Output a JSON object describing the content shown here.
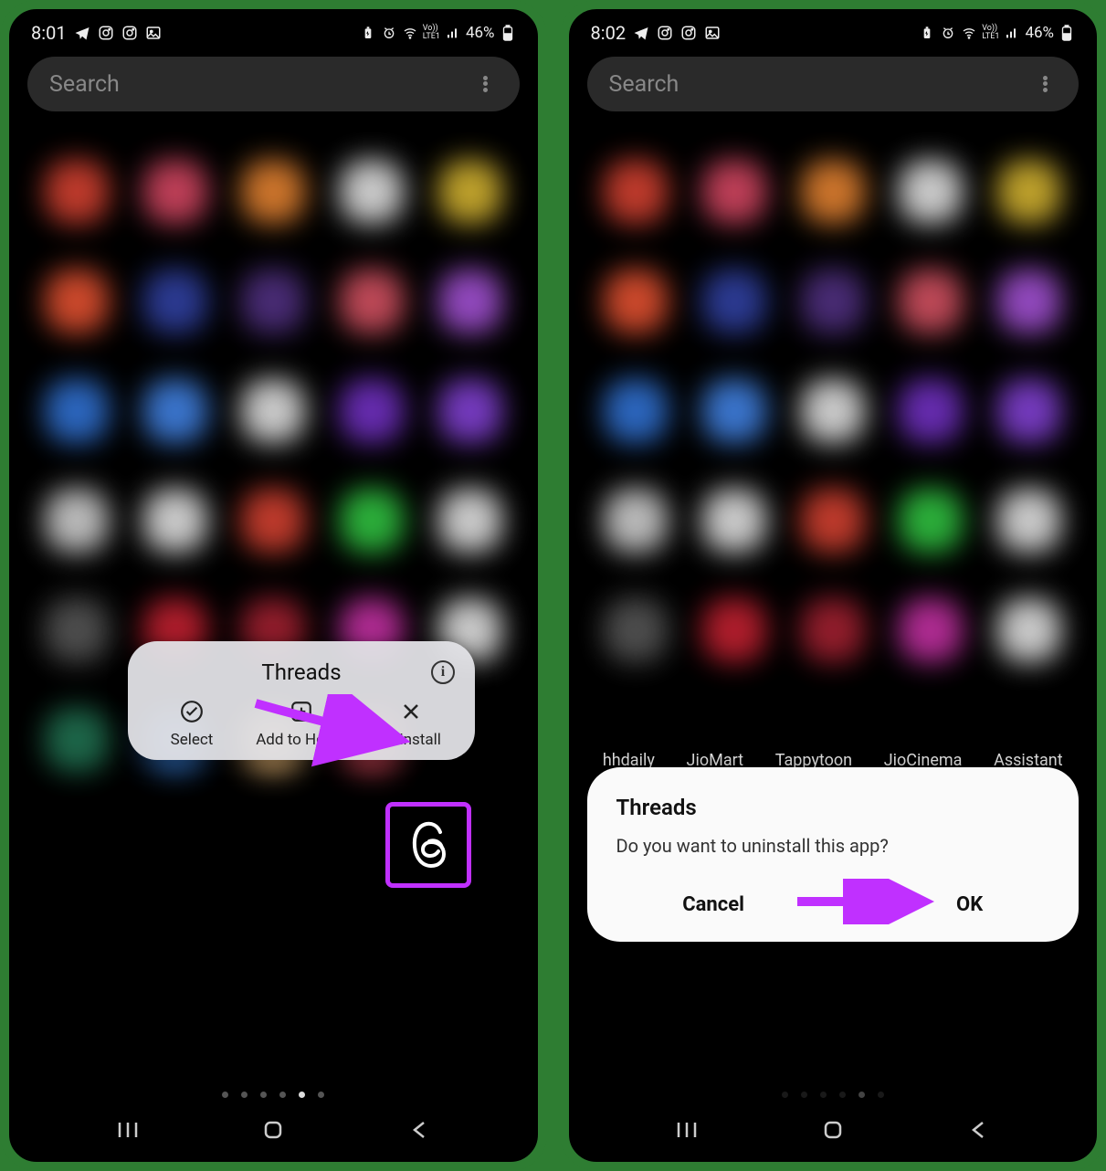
{
  "left": {
    "status": {
      "time": "8:01",
      "battery": "46%"
    },
    "search": {
      "placeholder": "Search"
    },
    "popup": {
      "title": "Threads",
      "actions": {
        "select": "Select",
        "add_home": "Add to Home",
        "uninstall": "Uninstall"
      }
    },
    "page_indicator": {
      "pages": 6,
      "active": 4
    }
  },
  "right": {
    "status": {
      "time": "8:02",
      "battery": "46%"
    },
    "search": {
      "placeholder": "Search"
    },
    "app_labels": [
      "hhdaily",
      "JioMart",
      "Tappytoon",
      "JioCinema",
      "Assistant"
    ],
    "dialog": {
      "title": "Threads",
      "message": "Do you want to uninstall this app?",
      "cancel": "Cancel",
      "ok": "OK"
    }
  }
}
